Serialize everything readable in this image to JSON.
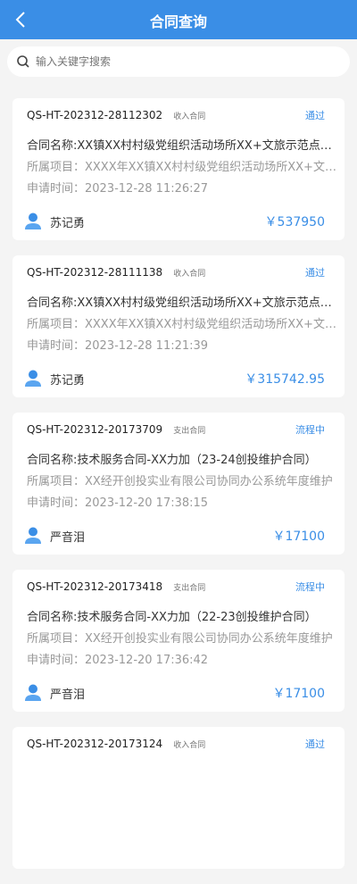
{
  "header": {
    "title": "合同查询",
    "back_icon": "chevron-left-icon"
  },
  "search": {
    "placeholder": "输入关键字搜索",
    "icon": "search-icon"
  },
  "colors": {
    "primary": "#3a8ee6",
    "background": "#f4f4f4"
  },
  "contracts": [
    {
      "code": "QS-HT-202312-28112302",
      "type": "收入合同",
      "status": "通过",
      "name": "合同名称:XX镇XX村村级党组织活动场所XX+文旅示范点建设项目",
      "project": "所属项目：XXXX年XX镇XX村村级党组织活动场所XX+文旅示范点",
      "time": "申请时间：2023-12-28 11:26:27",
      "person": "苏记勇",
      "amount": "￥537950"
    },
    {
      "code": "QS-HT-202312-28111138",
      "type": "收入合同",
      "status": "通过",
      "name": "合同名称:XX镇XX村村级党组织活动场所XX+文旅示范点建设项目",
      "project": "所属项目：XXXX年XX镇XX村村级党组织活动场所XX+文旅示范点",
      "time": "申请时间：2023-12-28 11:21:39",
      "person": "苏记勇",
      "amount": "￥315742.95"
    },
    {
      "code": "QS-HT-202312-20173709",
      "type": "支出合同",
      "status": "流程中",
      "name": "合同名称:技术服务合同-XX力加（23-24创投维护合同）",
      "project": "所属项目：XX经开创投实业有限公司协同办公系统年度维护",
      "time": "申请时间：2023-12-20 17:38:15",
      "person": "严音泪",
      "amount": "￥17100"
    },
    {
      "code": "QS-HT-202312-20173418",
      "type": "支出合同",
      "status": "流程中",
      "name": "合同名称:技术服务合同-XX力加（22-23创投维护合同）",
      "project": "所属项目：XX经开创投实业有限公司协同办公系统年度维护",
      "time": "申请时间：2023-12-20 17:36:42",
      "person": "严音泪",
      "amount": "￥17100"
    },
    {
      "code": "QS-HT-202312-20173124",
      "type": "收入合同",
      "status": "通过",
      "name": "",
      "project": "",
      "time": "",
      "person": "",
      "amount": ""
    }
  ]
}
